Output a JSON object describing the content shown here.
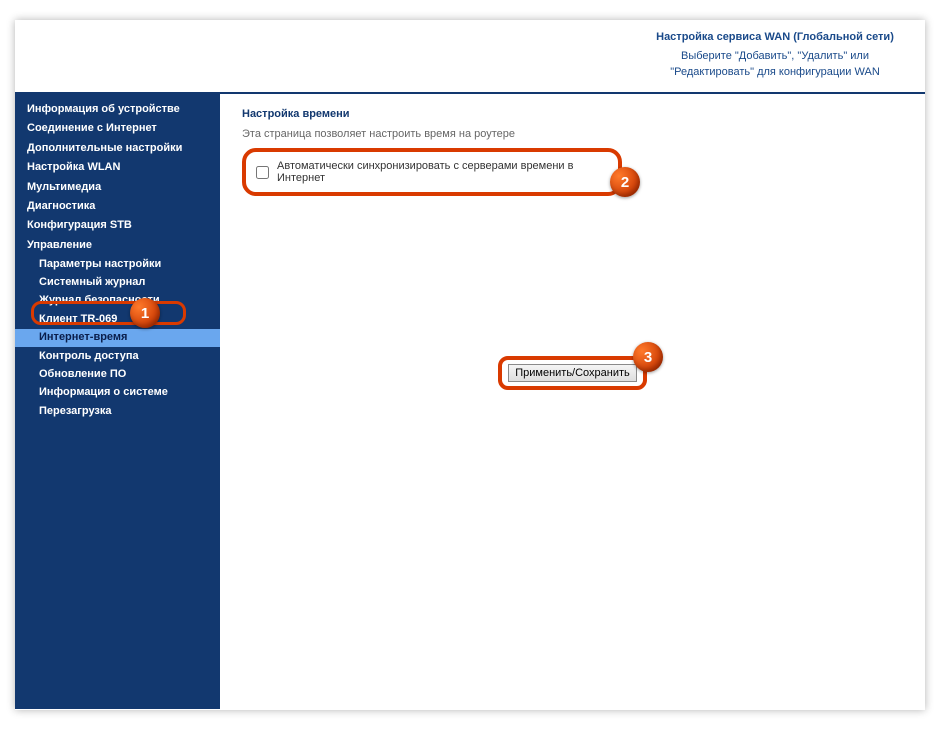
{
  "header": {
    "title": "Настройка сервиса WAN (Глобальной сети)",
    "desc": "Выберите \"Добавить\", \"Удалить\" или \"Редактировать\" для конфигурации WAN"
  },
  "sidebar": {
    "items": [
      {
        "label": "Информация об устройстве",
        "type": "item"
      },
      {
        "label": "Соединение с Интернет",
        "type": "item"
      },
      {
        "label": "Дополнительные настройки",
        "type": "item"
      },
      {
        "label": "Настройка WLAN",
        "type": "item"
      },
      {
        "label": "Мультимедиа",
        "type": "item"
      },
      {
        "label": "Диагностика",
        "type": "item"
      },
      {
        "label": "Конфигурация STB",
        "type": "item"
      },
      {
        "label": "Управление",
        "type": "item"
      },
      {
        "label": "Параметры настройки",
        "type": "sub"
      },
      {
        "label": "Системный журнал",
        "type": "sub"
      },
      {
        "label": "Журнал безопасности",
        "type": "sub"
      },
      {
        "label": "Клиент TR-069",
        "type": "sub"
      },
      {
        "label": "Интернет-время",
        "type": "sub",
        "active": true
      },
      {
        "label": "Контроль доступа",
        "type": "sub"
      },
      {
        "label": "Обновление ПО",
        "type": "sub"
      },
      {
        "label": "Информация о системе",
        "type": "sub"
      },
      {
        "label": "Перезагрузка",
        "type": "sub"
      }
    ]
  },
  "main": {
    "heading": "Настройка времени",
    "subtext": "Эта страница позволяет настроить время на роутере",
    "checkbox_label": "Автоматически синхронизировать с серверами времени в Интернет",
    "apply_label": "Применить/Сохранить"
  },
  "callouts": {
    "one": "1",
    "two": "2",
    "three": "3"
  }
}
